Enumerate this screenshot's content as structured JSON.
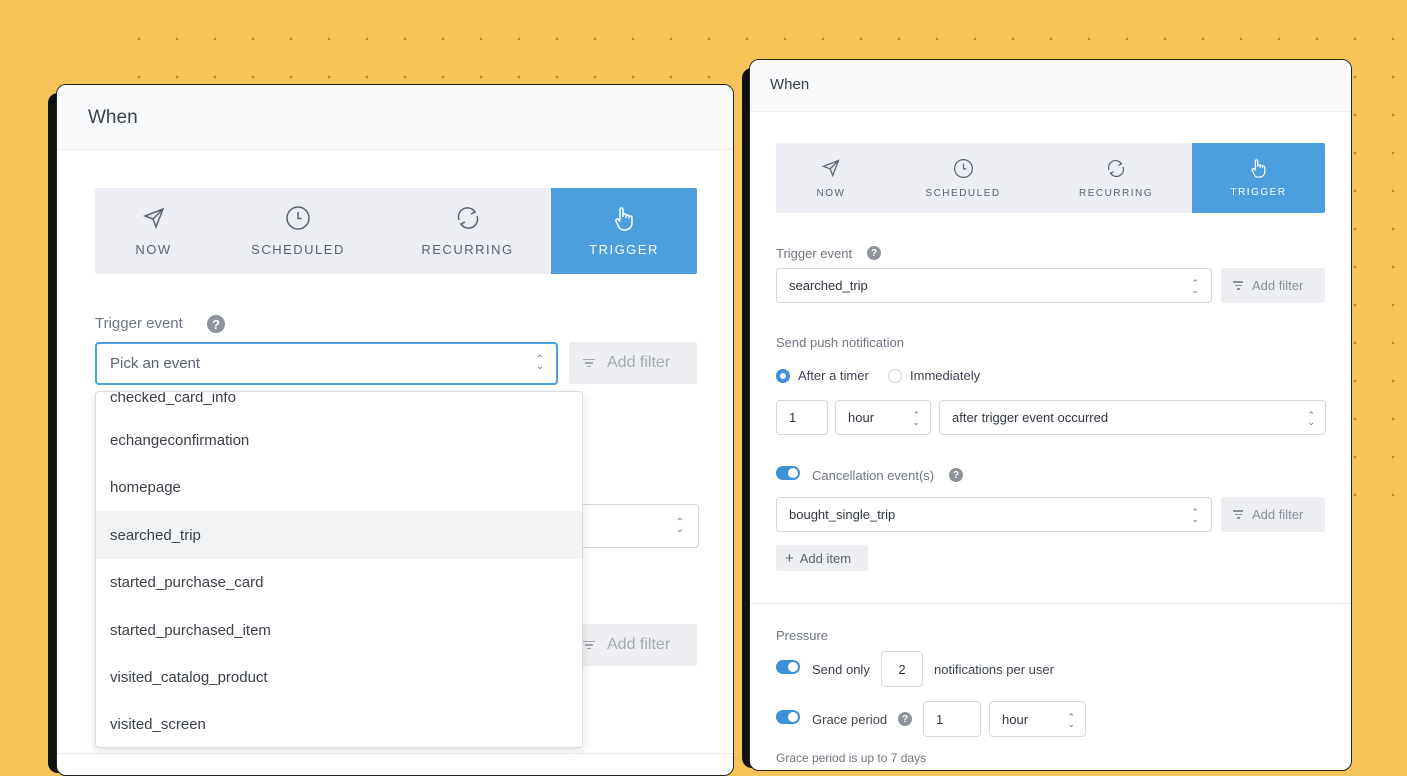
{
  "left_panel": {
    "header_title": "When",
    "tabs": [
      {
        "label": "NOW",
        "icon": "send-icon"
      },
      {
        "label": "SCHEDULED",
        "icon": "clock-icon"
      },
      {
        "label": "RECURRING",
        "icon": "refresh-icon"
      },
      {
        "label": "TRIGGER",
        "icon": "pointer-hand-icon",
        "active": true
      }
    ],
    "trigger_event_label": "Trigger event",
    "event_select_placeholder": "Pick an event",
    "add_filter_label": "Add filter",
    "dropdown_items": [
      "checked_card_info",
      "echangeconfirmation",
      "homepage",
      "searched_trip",
      "started_purchase_card",
      "started_purchased_item",
      "visited_catalog_product",
      "visited_screen"
    ],
    "highlighted_item": "searched_trip",
    "add_filter_label_2": "Add filter"
  },
  "right_panel": {
    "header_title": "When",
    "tabs": [
      {
        "label": "NOW",
        "icon": "send-icon"
      },
      {
        "label": "SCHEDULED",
        "icon": "clock-icon"
      },
      {
        "label": "RECURRING",
        "icon": "refresh-icon"
      },
      {
        "label": "TRIGGER",
        "icon": "pointer-hand-icon",
        "active": true
      }
    ],
    "trigger_event_label": "Trigger event",
    "trigger_event_value": "searched_trip",
    "add_filter_label": "Add filter",
    "send_push_label": "Send push notification",
    "radio_after_timer": "After a timer",
    "radio_immediately": "Immediately",
    "timer_value": "1",
    "timer_unit": "hour",
    "timer_reference": "after trigger event occurred",
    "cancellation_label": "Cancellation event(s)",
    "cancellation_value": "bought_single_trip",
    "cancellation_add_filter": "Add filter",
    "add_item_label": "Add item",
    "pressure_label": "Pressure",
    "send_only_label": "Send only",
    "send_only_value": "2",
    "notifications_per_user": "notifications per user",
    "grace_period_label": "Grace period",
    "grace_value": "1",
    "grace_unit": "hour",
    "grace_note": "Grace period is up to 7 days"
  },
  "colors": {
    "background": "#f7c45a",
    "accent": "#4a9fdc",
    "toggle": "#3d8fd6"
  }
}
